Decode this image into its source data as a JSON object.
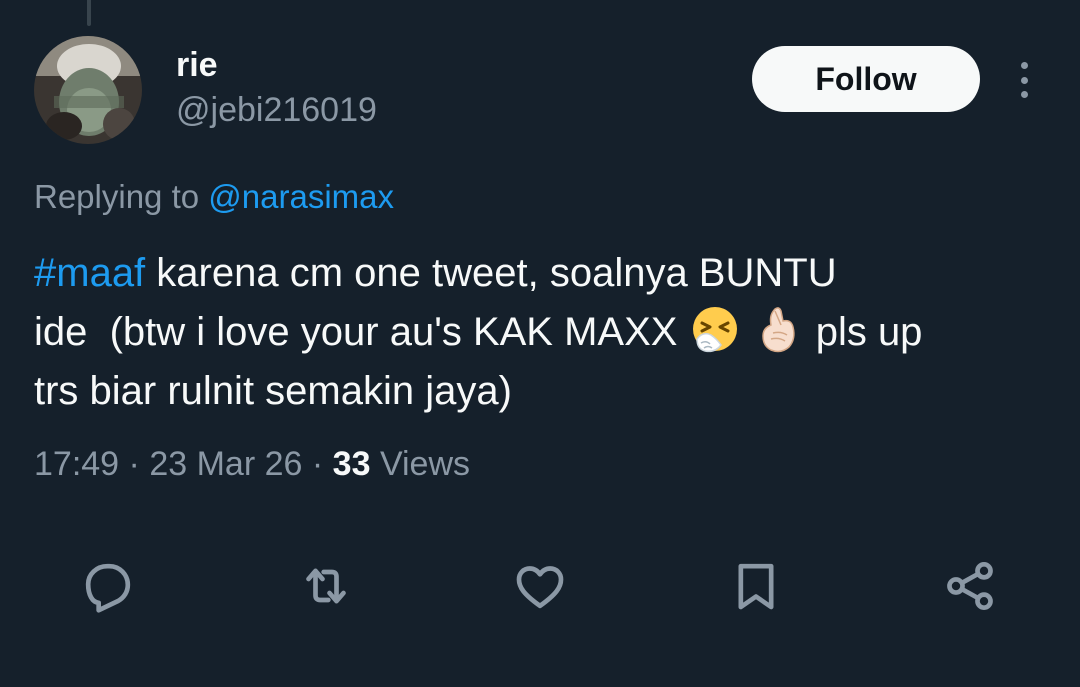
{
  "tweet": {
    "display_name": "rie",
    "handle": "@jebi216019",
    "follow_label": "Follow",
    "replying_prefix": "Replying to",
    "replying_handle": "@narasimax",
    "hashtag": "#maaf",
    "text_line1_rest": " karena cm one tweet, soalnya BUNTU",
    "text_line2_a": "ide  (btw i love your au's KAK MAXX ",
    "text_line2_b": " pls up",
    "text_line3": "trs biar rulnit semakin jaya)",
    "emojis": [
      "sneezing-face-emoji",
      "hand-with-index-finger-and-thumb-crossed-emoji"
    ],
    "time": "17:49",
    "date": "23 Mar 26",
    "separator": "·",
    "views_count": "33",
    "views_label": "Views"
  },
  "actions": [
    "reply-icon",
    "retweet-icon",
    "like-icon",
    "bookmark-icon",
    "share-icon"
  ],
  "colors": {
    "background": "#15202b",
    "text": "#f7f9f9",
    "secondary_text": "#8b98a5",
    "link": "#1d9bf0",
    "follow_bg": "#f7f9f9"
  }
}
